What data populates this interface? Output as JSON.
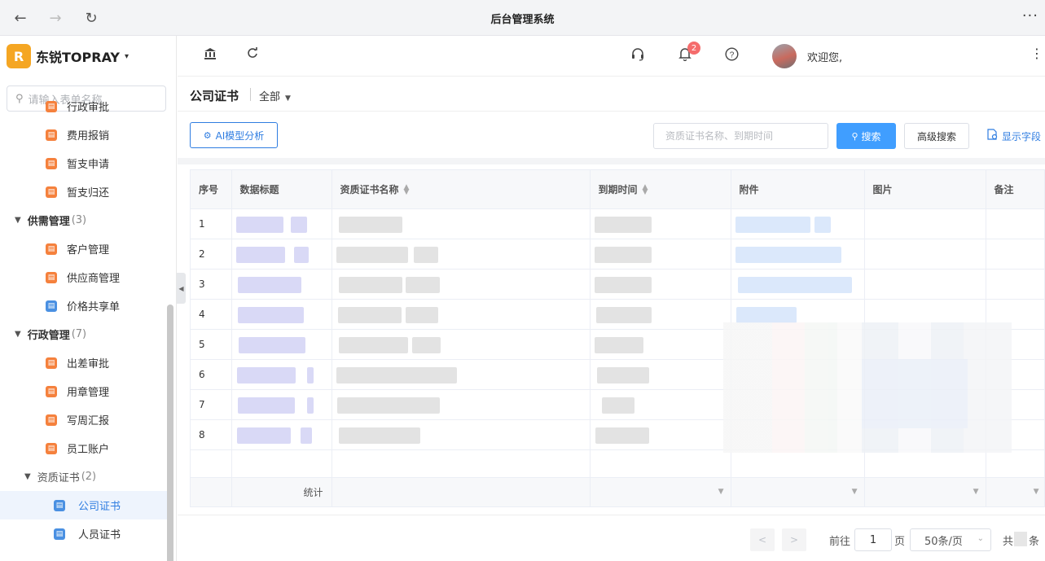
{
  "browser": {
    "title": "后台管理系统",
    "back_icon": "←",
    "forward_icon": "→",
    "reload_icon": "↻",
    "more_icon": "···"
  },
  "brand": {
    "logo_text": "R",
    "name": "东锐TOPRAY",
    "caret": "▾"
  },
  "sidebar": {
    "search_placeholder": "请输入表单名称",
    "items": [
      {
        "label": "行政审批",
        "type": "leaf",
        "color": "orange"
      },
      {
        "label": "费用报销",
        "type": "leaf",
        "color": "orange"
      },
      {
        "label": "暂支申请",
        "type": "leaf",
        "color": "orange"
      },
      {
        "label": "暂支归还",
        "type": "leaf",
        "color": "orange"
      },
      {
        "label": "供需管理",
        "count": "(3)",
        "type": "group"
      },
      {
        "label": "客户管理",
        "type": "leaf",
        "color": "orange"
      },
      {
        "label": "供应商管理",
        "type": "leaf",
        "color": "orange"
      },
      {
        "label": "价格共享单",
        "type": "leaf",
        "color": "blue"
      },
      {
        "label": "行政管理",
        "count": "(7)",
        "type": "group"
      },
      {
        "label": "出差审批",
        "type": "leaf",
        "color": "orange"
      },
      {
        "label": "用章管理",
        "type": "leaf",
        "color": "orange"
      },
      {
        "label": "写周汇报",
        "type": "leaf",
        "color": "orange"
      },
      {
        "label": "员工账户",
        "type": "leaf",
        "color": "orange"
      },
      {
        "label": "资质证书",
        "count": "(2)",
        "type": "sub"
      },
      {
        "label": "公司证书",
        "type": "leaf2",
        "color": "blue",
        "active": true
      },
      {
        "label": "人员证书",
        "type": "leaf2",
        "color": "blue"
      }
    ],
    "collapse_icon": "◀"
  },
  "header": {
    "bell_badge": "2",
    "welcome": "欢迎您,",
    "kebab": "⋮"
  },
  "page": {
    "title": "公司证书",
    "scope": "全部",
    "ai_button": "AI模型分析",
    "search_placeholder": "资质证书名称、到期时间",
    "search_button": "搜索",
    "advanced_button": "高级搜索",
    "fields_link": "显示字段"
  },
  "table": {
    "columns": [
      "序号",
      "数据标题",
      "资质证书名称",
      "到期时间",
      "附件",
      "图片",
      "备注"
    ],
    "rows": [
      "1",
      "2",
      "3",
      "4",
      "5",
      "6",
      "7",
      "8"
    ],
    "summary_label": "统计",
    "dropdown_icon": "▼"
  },
  "pagination": {
    "prev": "<",
    "next": ">",
    "goto_label": "前往",
    "page": "1",
    "page_suffix": "页",
    "page_size": "50条/页",
    "total_prefix": "共",
    "total_suffix": "条"
  },
  "colors": {
    "accent": "#409eff",
    "link": "#2f7de1",
    "badge": "#f56c6c",
    "icon_orange": "#f5813d",
    "icon_blue": "#4a90e2"
  }
}
